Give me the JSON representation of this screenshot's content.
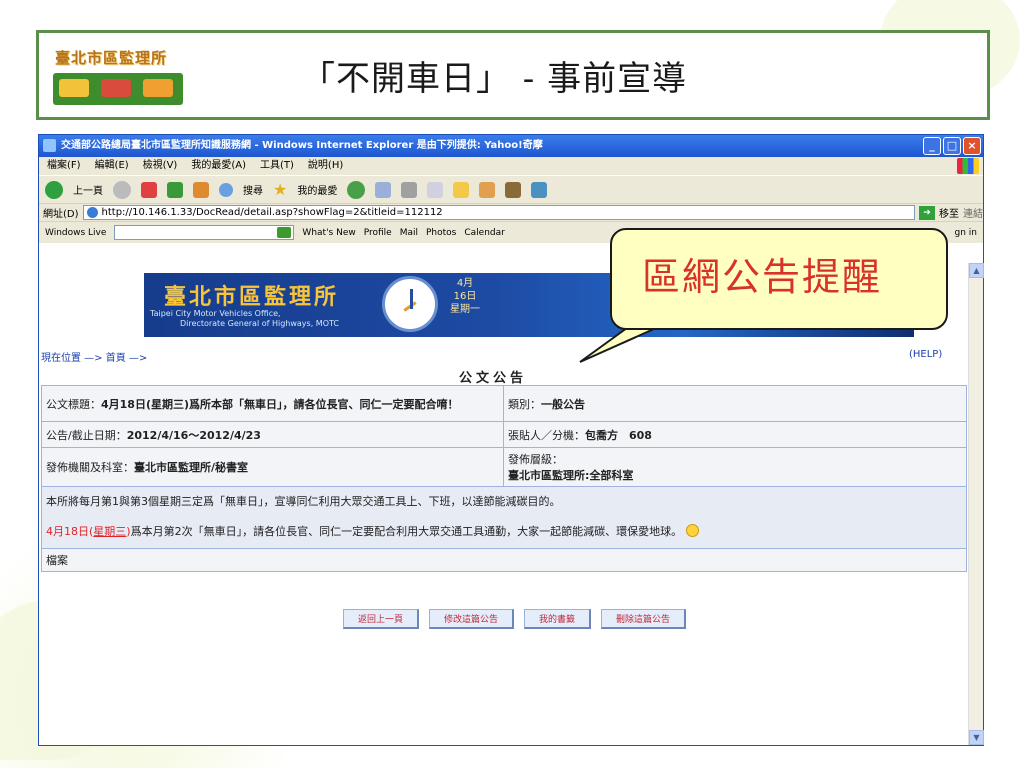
{
  "slide": {
    "logo_text": "臺北市區監理所",
    "title": "「不開車日」 - 事前宣導"
  },
  "browser": {
    "window_title": "交通部公路總局臺北市區監理所知識服務網 - Windows Internet Explorer 是由下列提供: Yahoo!奇摩",
    "menu": [
      "檔案(F)",
      "編輯(E)",
      "檢視(V)",
      "我的最愛(A)",
      "工具(T)",
      "說明(H)"
    ],
    "toolbar": {
      "back": "上一頁",
      "search": "搜尋",
      "favorites": "我的最愛"
    },
    "address_label": "網址(D)",
    "address_url": "http://10.146.1.33/DocRead/detail.asp?showFlag=2&titleid=112112",
    "go_label": "移至",
    "links_label": "連結",
    "links_bar": {
      "windows_live": "Windows Live",
      "items": [
        "What's New",
        "Profile",
        "Mail",
        "Photos",
        "Calendar"
      ],
      "sign_in": "gn in"
    }
  },
  "page": {
    "banner_title": "臺北市區監理所",
    "banner_sub": "Taipei City Motor Vehicles Office,",
    "banner_sub2": "Directorate General of Highways, MOTC",
    "banner_date": [
      "4月",
      "16日",
      "星期一"
    ],
    "breadcrumb": "現在位置 —> 首頁 —>",
    "help": "(HELP)",
    "heading": "公文公告",
    "notice": {
      "subject_label": "公文標題：",
      "subject": "4月18日(星期三)爲所本部「無車日」，請各位長官、同仁一定要配合唷！",
      "category_label": "類別：",
      "category": "一般公告",
      "dates_label": "公告/截止日期：",
      "dates": "2012/4/16～2012/4/23",
      "poster_label": "張貼人／分機：",
      "poster": "包喬方　608",
      "office_label": "發佈機關及科室：",
      "office": "臺北市區監理所/秘書室",
      "level_label": "發佈層級：",
      "level": "臺北市區監理所:全部科室",
      "body_line1": "本所將每月第1與第3個星期三定爲「無車日」，宣導同仁利用大眾交通工具上、下班，以達節能減碳目的。",
      "body_date": "4月18日(",
      "body_weekday": "星期三",
      "body_date_end": ")",
      "body_line2": "爲本月第2次「無車日」，請各位長官、同仁一定要配合利用大眾交通工具通勤，大家一起節能減碳、環保愛地球。",
      "attachment_label": "檔案"
    },
    "actions": [
      "返回上一頁",
      "修改這篇公告",
      "我的書籤",
      "刪除這篇公告"
    ]
  },
  "callout": {
    "text": "區網公告提醒"
  },
  "colors": {
    "accent_green": "#5a8e4a",
    "callout_fill": "#ffffc2",
    "callout_text": "#d8322a",
    "ie_blue": "#1e56d0"
  }
}
